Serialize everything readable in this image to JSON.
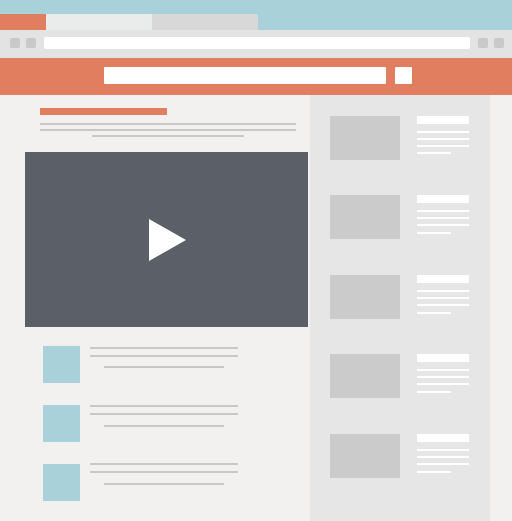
{
  "browser": {
    "tabs": [
      {
        "label": "",
        "state": "active"
      },
      {
        "label": "",
        "state": "inactive"
      },
      {
        "label": "",
        "state": "inactive"
      }
    ],
    "address_bar": {
      "value": "",
      "placeholder": ""
    },
    "icons": [
      "back-icon",
      "forward-icon",
      "bookmark-icon",
      "menu-icon"
    ]
  },
  "site": {
    "search": {
      "value": "",
      "placeholder": ""
    },
    "search_icon": "search-icon",
    "article": {
      "title": "",
      "subtitle": ""
    },
    "video": {
      "play_icon": "play-icon"
    },
    "related_list_count": 3,
    "sidebar_card_count": 5
  },
  "colors": {
    "accent": "#e07e5f",
    "tabstrip": "#a9d1da",
    "page_background": "#f3f1ef",
    "sidebar_background": "#e6e6e6",
    "video_background": "#5b5f67",
    "thumbnail_blue": "#a9d1da",
    "thumbnail_gray": "#cbcbcb",
    "placeholder_line": "#c8c8c8"
  }
}
